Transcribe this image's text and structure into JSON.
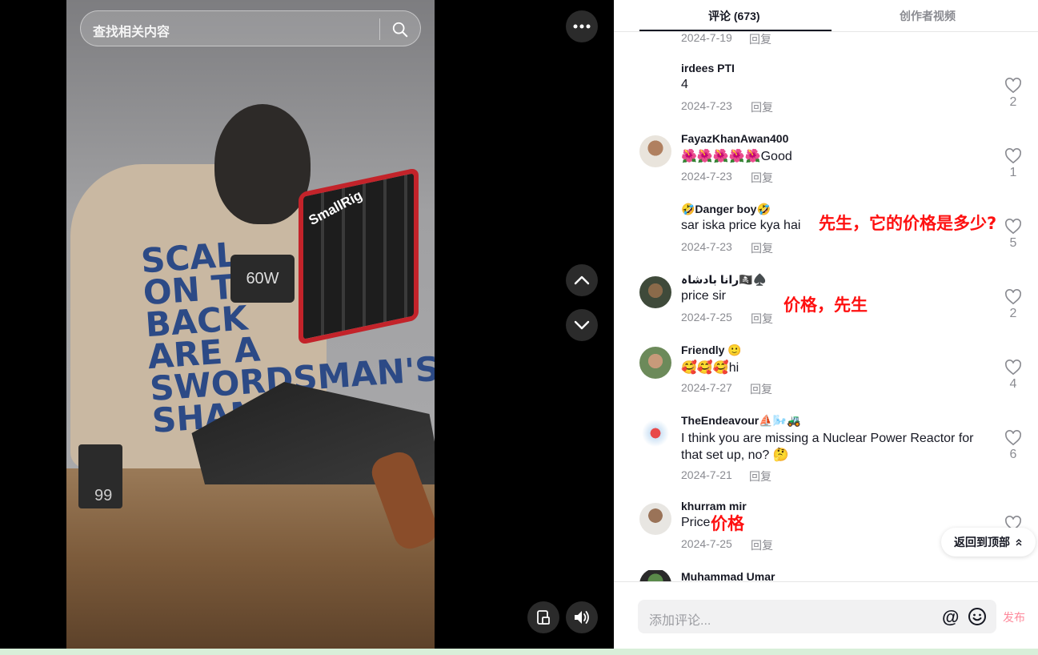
{
  "search": {
    "placeholder": "查找相关内容"
  },
  "video": {
    "shirt_text": "SCAL ON THE BACK ARE A SWORDSMAN'S SHAME",
    "brand": "SmallRig",
    "lamp_label": "60W",
    "battery_label": "99"
  },
  "tabs": {
    "comments": "评论 (673)",
    "creator_videos": "创作者视频"
  },
  "prev_comment": {
    "date": "2024-7-19",
    "reply": "回复"
  },
  "comments": [
    {
      "name": "irdees PTI",
      "text": "4",
      "date": "2024-7-23",
      "reply": "回复",
      "likes": "2",
      "has_avatar": false
    },
    {
      "name": "FayazKhanAwan400",
      "text": "🌺🌺🌺🌺🌺Good",
      "date": "2024-7-23",
      "reply": "回复",
      "likes": "1",
      "has_avatar": true
    },
    {
      "name": "🤣Danger boy🤣",
      "text": "sar iska price kya hai",
      "date": "2024-7-23",
      "reply": "回复",
      "likes": "5",
      "has_avatar": false
    },
    {
      "name": "رانا بادشاہ🏴‍☠️♠️",
      "text": "price sir",
      "date": "2024-7-25",
      "reply": "回复",
      "likes": "2",
      "has_avatar": true
    },
    {
      "name": "Friendly 🙂",
      "text": "🥰🥰🥰hi",
      "date": "2024-7-27",
      "reply": "回复",
      "likes": "4",
      "has_avatar": true
    },
    {
      "name": "TheEndeavour⛵🌬️🚜",
      "text": "I think you are missing a Nuclear Power Reactor for that set up, no? 🤔",
      "date": "2024-7-21",
      "reply": "回复",
      "likes": "6",
      "has_avatar": true
    },
    {
      "name": "khurram mir",
      "text": "Price",
      "date": "2024-7-25",
      "reply": "回复",
      "likes": "",
      "has_avatar": true
    },
    {
      "name": "Muhammad Umar",
      "text": "",
      "date": "",
      "reply": "",
      "likes": "",
      "has_avatar": true
    }
  ],
  "annotations": {
    "danger_boy": "先生，它的价格是多少?",
    "rana": "价格，先生",
    "khurram": "价格"
  },
  "back_to_top": "返回到顶部",
  "input": {
    "placeholder": "添加评论...",
    "publish": "发布"
  },
  "colors": {
    "annotation": "#fe1010",
    "publish": "#fe8a9c",
    "muted": "#8a8b91"
  }
}
